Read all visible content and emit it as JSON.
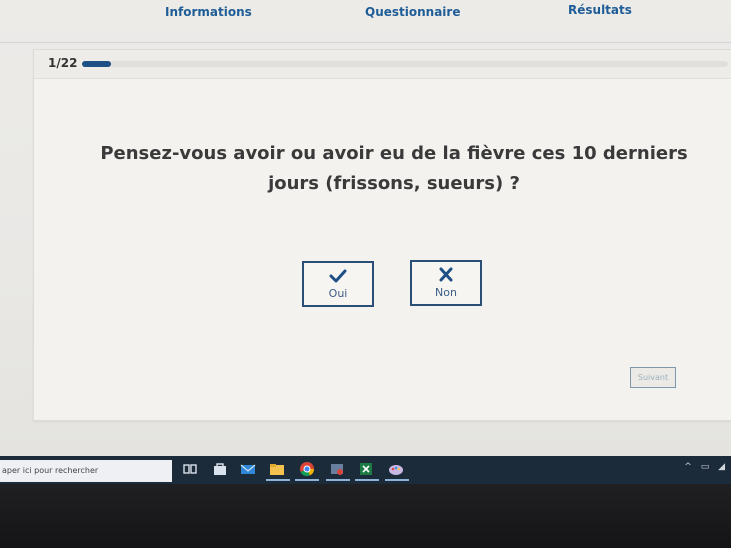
{
  "nav": {
    "tabs": [
      {
        "label": "Informations"
      },
      {
        "label": "Questionnaire"
      },
      {
        "label": "Résultats"
      }
    ]
  },
  "progress": {
    "counter": "1/22",
    "current": 1,
    "total": 22,
    "fraction": 0.045
  },
  "question": {
    "text": "Pensez-vous avoir ou avoir eu de la fièvre ces 10 derniers jours (frissons, sueurs) ?"
  },
  "answers": {
    "yes": {
      "label": "Oui",
      "icon": "check-icon"
    },
    "no": {
      "label": "Non",
      "icon": "close-icon"
    }
  },
  "next_button": {
    "label": "Suivant"
  },
  "taskbar": {
    "search_text": "aper ici pour rechercher"
  },
  "colors": {
    "accent": "#1f5d97",
    "button_border": "#2b4e78",
    "taskbar": "#1c2b3a"
  }
}
